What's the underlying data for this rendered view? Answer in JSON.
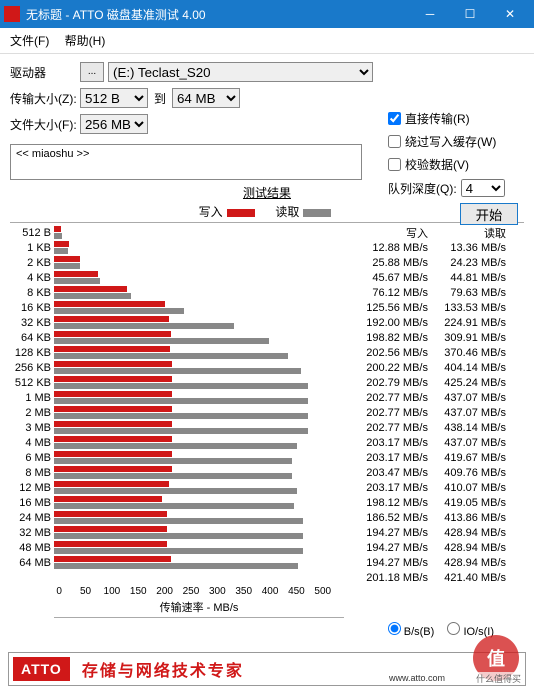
{
  "title": "无标题 - ATTO 磁盘基准测试 4.00",
  "menu": {
    "file": "文件(F)",
    "help": "帮助(H)"
  },
  "labels": {
    "drive": "驱动器",
    "transfer": "传输大小(Z):",
    "to": "到",
    "filesize": "文件大小(F):",
    "queue": "队列深度(Q):",
    "start": "开始",
    "results": "测试结果",
    "write": "写入",
    "read": "读取",
    "xlabel": "传输速率 - MB/s",
    "bs": "B/s(B)",
    "ios": "IO/s(I)"
  },
  "drive_sel": "(E:) Teclast_S20",
  "tmin": "512 B",
  "tmax": "64 MB",
  "fsize": "256 MB",
  "opts": {
    "direct": "直接传输(R)",
    "bypass": "绕过写入缓存(W)",
    "verify": "校验数据(V)"
  },
  "queue_val": "4",
  "desc": "<< miaoshu >>",
  "footer": {
    "brand": "ATTO",
    "text": "存储与网络技术专家",
    "url": "www.atto.com"
  },
  "watermark": "什么值得买",
  "xticks": [
    "0",
    "50",
    "100",
    "150",
    "200",
    "250",
    "300",
    "350",
    "400",
    "450",
    "500"
  ],
  "chart_data": {
    "type": "bar",
    "xlabel": "传输速率 - MB/s",
    "xlim": [
      0,
      500
    ],
    "series_names": [
      "写入",
      "读取"
    ],
    "categories": [
      "512 B",
      "1 KB",
      "2 KB",
      "4 KB",
      "8 KB",
      "16 KB",
      "32 KB",
      "64 KB",
      "128 KB",
      "256 KB",
      "512 KB",
      "1 MB",
      "2 MB",
      "3 MB",
      "4 MB",
      "6 MB",
      "8 MB",
      "12 MB",
      "16 MB",
      "24 MB",
      "32 MB",
      "48 MB",
      "64 MB"
    ],
    "rows": [
      {
        "l": "512 B",
        "w": 12.88,
        "r": 13.36
      },
      {
        "l": "1 KB",
        "w": 25.88,
        "r": 24.23
      },
      {
        "l": "2 KB",
        "w": 45.67,
        "r": 44.81
      },
      {
        "l": "4 KB",
        "w": 76.12,
        "r": 79.63
      },
      {
        "l": "8 KB",
        "w": 125.56,
        "r": 133.53
      },
      {
        "l": "16 KB",
        "w": 192,
        "r": 224.91
      },
      {
        "l": "32 KB",
        "w": 198.82,
        "r": 309.91
      },
      {
        "l": "64 KB",
        "w": 202.56,
        "r": 370.46
      },
      {
        "l": "128 KB",
        "w": 200.22,
        "r": 404.14
      },
      {
        "l": "256 KB",
        "w": 202.79,
        "r": 425.24
      },
      {
        "l": "512 KB",
        "w": 202.77,
        "r": 437.07
      },
      {
        "l": "1 MB",
        "w": 202.77,
        "r": 437.07
      },
      {
        "l": "2 MB",
        "w": 202.77,
        "r": 438.14
      },
      {
        "l": "3 MB",
        "w": 203.17,
        "r": 437.07
      },
      {
        "l": "4 MB",
        "w": 203.17,
        "r": 419.67
      },
      {
        "l": "6 MB",
        "w": 203.47,
        "r": 409.76
      },
      {
        "l": "8 MB",
        "w": 203.17,
        "r": 410.07
      },
      {
        "l": "12 MB",
        "w": 198.12,
        "r": 419.05
      },
      {
        "l": "16 MB",
        "w": 186.52,
        "r": 413.86
      },
      {
        "l": "24 MB",
        "w": 194.27,
        "r": 428.94
      },
      {
        "l": "32 MB",
        "w": 194.27,
        "r": 428.94
      },
      {
        "l": "48 MB",
        "w": 194.27,
        "r": 428.94
      },
      {
        "l": "64 MB",
        "w": 201.18,
        "r": 421.4
      }
    ]
  }
}
